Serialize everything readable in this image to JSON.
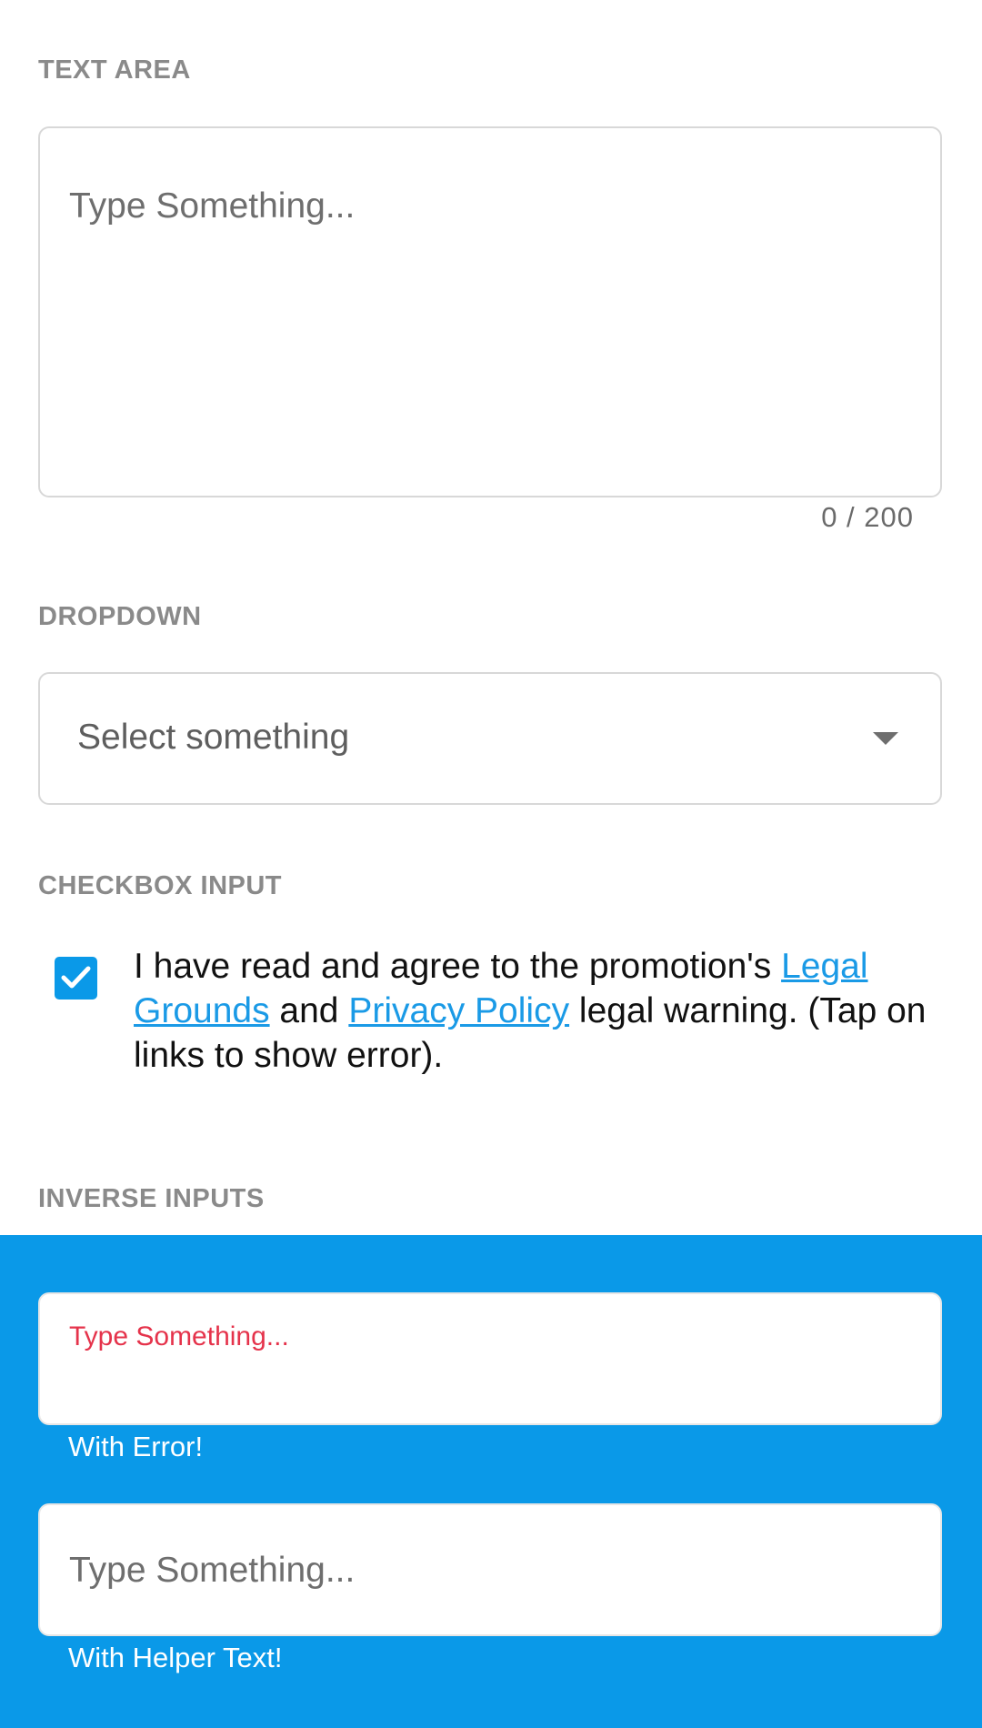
{
  "text_area": {
    "label": "TEXT AREA",
    "placeholder": "Type Something...",
    "counter": "0 / 200"
  },
  "dropdown": {
    "label": "DROPDOWN",
    "value": "Select something",
    "caret_icon": "caret-down-icon"
  },
  "checkbox_input": {
    "label": "CHECKBOX INPUT",
    "checked": true,
    "text_before": "I have read and agree to the promotion's ",
    "link_legal": "Legal Grounds",
    "text_middle": " and ",
    "link_privacy": "Privacy Policy",
    "text_after": " legal warning. (Tap on links to show error).",
    "accent_color": "#0a99e8"
  },
  "inverse_inputs": {
    "label": "INVERSE INPUTS",
    "background_color": "#0a99e8",
    "error_input": {
      "placeholder": "Type Something...",
      "helper": "With Error!",
      "error_color": "#e5334b"
    },
    "helper_input": {
      "placeholder": "Type Something...",
      "helper": "With Helper Text!"
    }
  }
}
